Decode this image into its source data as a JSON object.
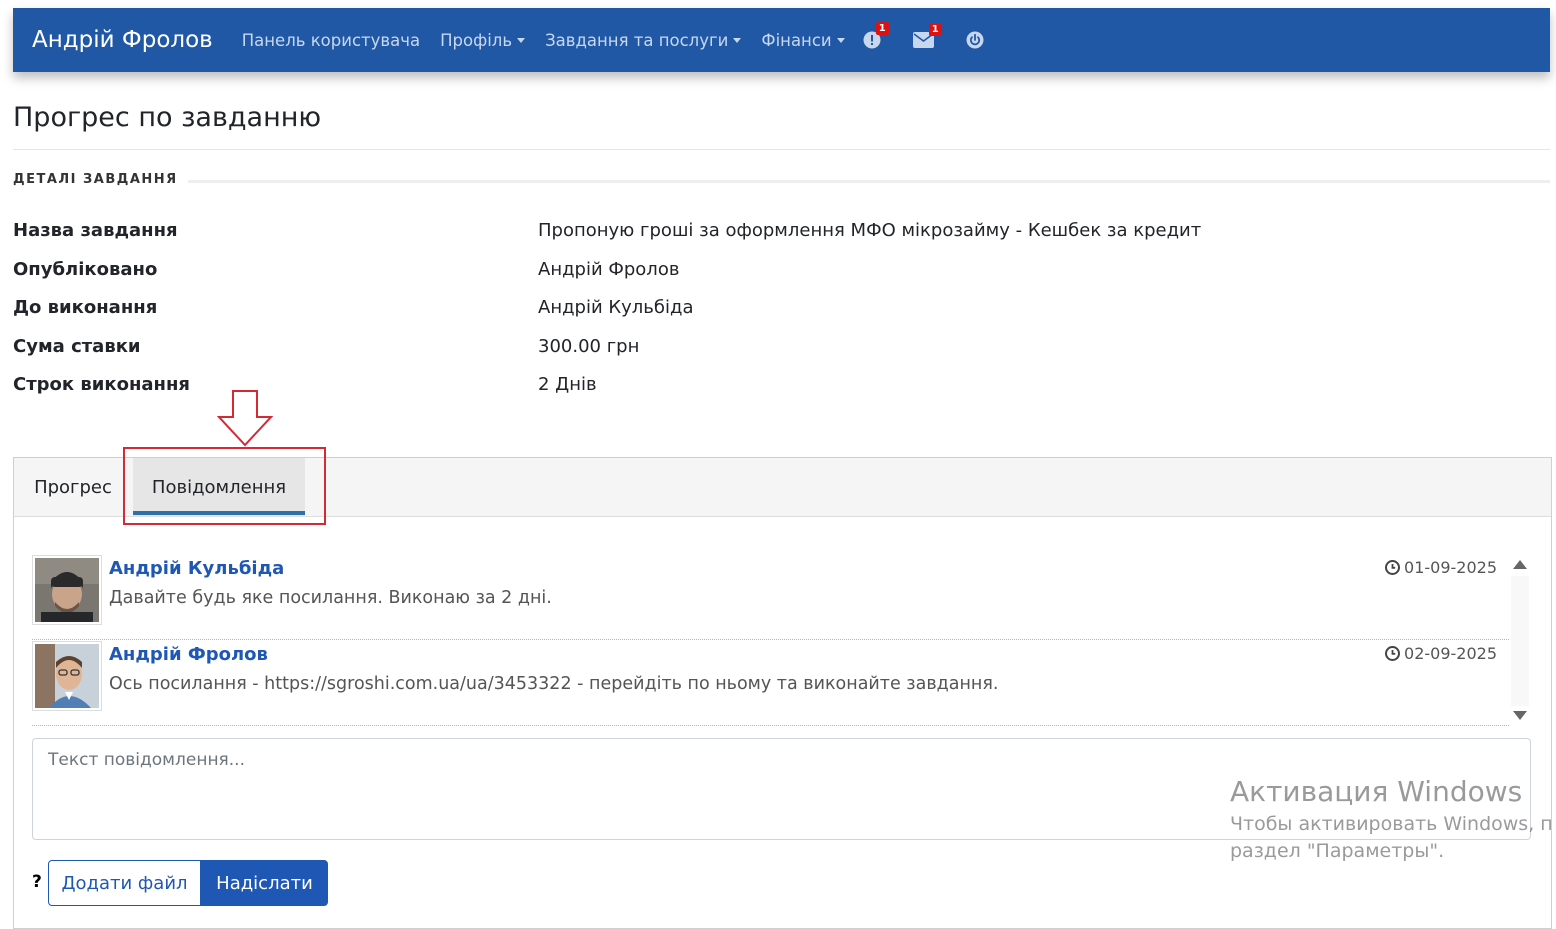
{
  "navbar": {
    "brand": "Андрій Фролов",
    "items": [
      {
        "label": "Панель користувача",
        "dropdown": false
      },
      {
        "label": "Профіль",
        "dropdown": true
      },
      {
        "label": "Завдання та послуги",
        "dropdown": true
      },
      {
        "label": "Фінанси",
        "dropdown": true
      }
    ],
    "alerts_badge": "1",
    "messages_badge": "1",
    "icons": [
      "alert-icon",
      "envelope-icon",
      "power-icon"
    ],
    "color": "#2158a6"
  },
  "page": {
    "title": "Прогрес по завданню",
    "section_label": "ДЕТАЛІ ЗАВДАННЯ"
  },
  "details": [
    {
      "label": "Назва завдання",
      "value": "Пропоную гроші за оформлення МФО мікрозайму - Кешбек за кредит"
    },
    {
      "label": "Опубліковано",
      "value": "Андрій Фролов"
    },
    {
      "label": "До виконання",
      "value": "Андрій Кульбіда"
    },
    {
      "label": "Сума ставки",
      "value": "300.00 грн"
    },
    {
      "label": "Строк виконання",
      "value": "2 Днів"
    }
  ],
  "tabs": [
    {
      "label": "Прогрес",
      "active": false
    },
    {
      "label": "Повідомлення",
      "active": true
    }
  ],
  "messages": [
    {
      "author": "Андрій Кульбіда",
      "date": "01-09-2025",
      "text": "Давайте будь яке посилання. Виконаю за 2 дні."
    },
    {
      "author": "Андрій Фролов",
      "date": "02-09-2025",
      "text": "Ось посилання - https://sgroshi.com.ua/ua/3453322 - перейдіть по ньому та виконайте завдання."
    }
  ],
  "compose": {
    "placeholder": "Текст повідомлення...",
    "help": "?",
    "attach_label": "Додати файл",
    "send_label": "Надіслати"
  },
  "watermark": {
    "title": "Активация Windows",
    "line1": "Чтобы активировать Windows, п",
    "line2": "раздел \"Параметры\"."
  },
  "colors": {
    "link": "#1f57b4",
    "annotation": "#d42a35",
    "badge": "#dd1111"
  }
}
